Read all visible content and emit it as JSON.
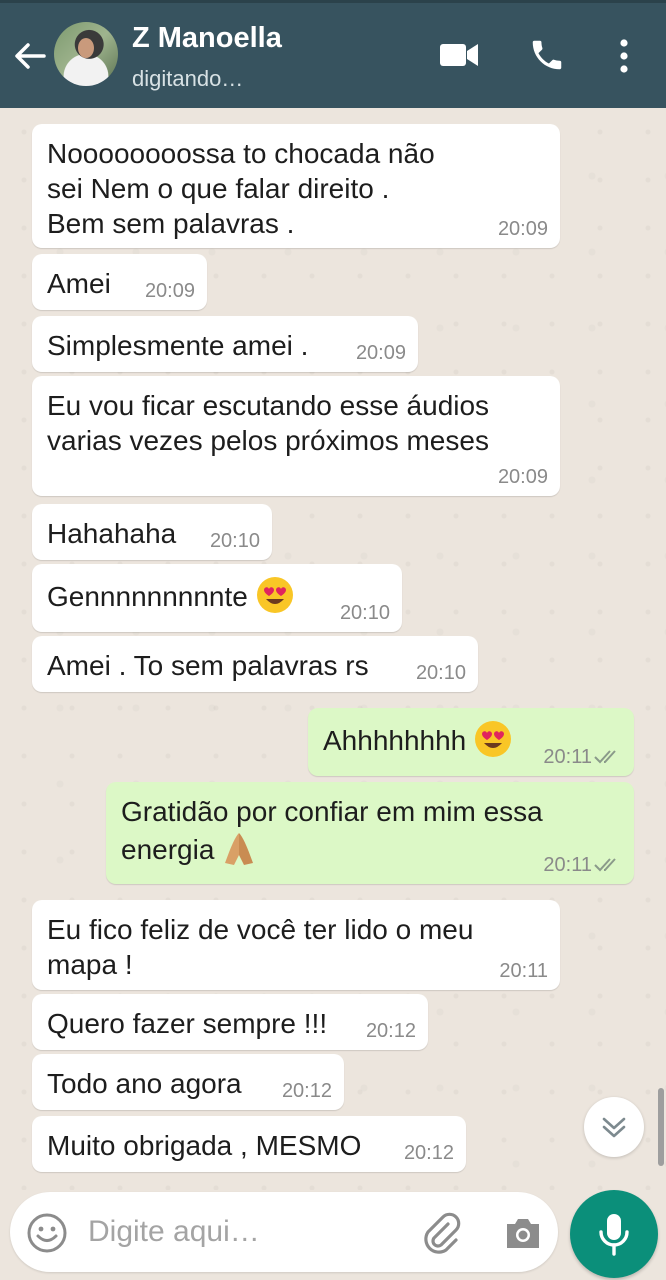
{
  "header": {
    "contact_name": "Z Manoella",
    "status": "digitando…"
  },
  "icons": {
    "back": "back-arrow-icon",
    "video": "video-call-icon",
    "call": "phone-call-icon",
    "menu": "more-options-icon",
    "scroll": "chevrons-down-icon",
    "emoji": "emoji-icon",
    "attach": "paperclip-icon",
    "camera": "camera-icon",
    "mic": "microphone-icon",
    "ticks": "double-check-icon",
    "heart_eyes": "heart-eyes-emoji",
    "pray": "folded-hands-emoji"
  },
  "colors": {
    "header_bg": "#37535f",
    "incoming_bg": "#ffffff",
    "outgoing_bg": "#dcf8c6",
    "chat_bg": "#ece5dd",
    "mic_bg": "#0b8f7a"
  },
  "messages": [
    {
      "direction": "in",
      "text": "Noooooooossa to chocada não sei Nem o que falar direito . Bem sem palavras .",
      "time": "20:09"
    },
    {
      "direction": "in",
      "text": "Amei",
      "time": "20:09"
    },
    {
      "direction": "in",
      "text": "Simplesmente amei .",
      "time": "20:09"
    },
    {
      "direction": "in",
      "text": "Eu vou ficar escutando esse áudios varias vezes pelos próximos meses",
      "time": "20:09"
    },
    {
      "direction": "in",
      "text": "Hahahaha",
      "time": "20:10"
    },
    {
      "direction": "in",
      "text": "Gennnnnnnnnte",
      "emoji": "heart_eyes",
      "time": "20:10"
    },
    {
      "direction": "in",
      "text": "Amei . To sem palavras rs",
      "time": "20:10"
    },
    {
      "direction": "out",
      "text": "Ahhhhhhhh",
      "emoji": "heart_eyes",
      "time": "20:11",
      "status": "read"
    },
    {
      "direction": "out",
      "text": "Gratidão por confiar em mim essa energia",
      "emoji": "pray",
      "time": "20:11",
      "status": "read"
    },
    {
      "direction": "in",
      "text": "Eu fico feliz de você ter lido o meu mapa !",
      "time": "20:11"
    },
    {
      "direction": "in",
      "text": "Quero fazer sempre !!!",
      "time": "20:12"
    },
    {
      "direction": "in",
      "text": "Todo ano agora",
      "time": "20:12"
    },
    {
      "direction": "in",
      "text": "Muito obrigada , MESMO",
      "time": "20:12"
    }
  ],
  "composer": {
    "placeholder": "Digite aqui…",
    "value": ""
  }
}
